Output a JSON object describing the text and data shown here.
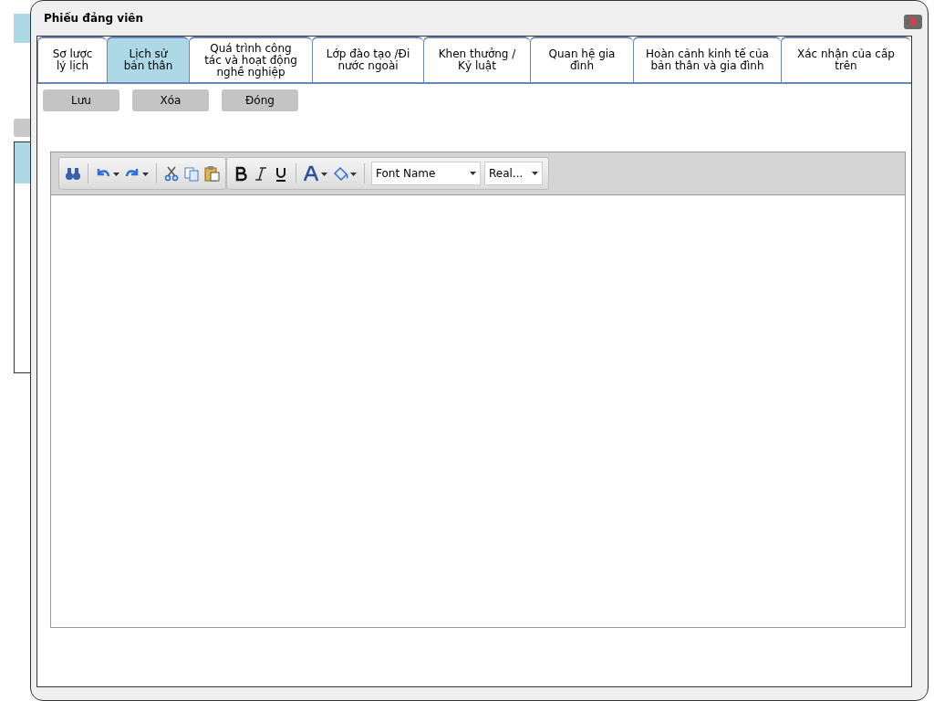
{
  "window": {
    "title": "Phiếu đảng viên",
    "close_label": "X"
  },
  "tabs": [
    {
      "label": "Sơ lược lý lịch",
      "selected": false
    },
    {
      "label": "Lịch sử bản thân",
      "selected": true
    },
    {
      "label": "Quá trình công tác và hoạt động nghề nghiệp",
      "selected": false
    },
    {
      "label": "Lớp đào tạo /Đi nước ngoài",
      "selected": false
    },
    {
      "label": "Khen thưởng / Kỷ luật",
      "selected": false
    },
    {
      "label": "Quan hệ gia đình",
      "selected": false
    },
    {
      "label": "Hoàn cảnh kinh tế của bản thân và gia đình",
      "selected": false
    },
    {
      "label": "Xác nhận của cấp trên",
      "selected": false
    }
  ],
  "buttons": [
    "Lưu",
    "Xóa",
    "Đóng"
  ],
  "editor": {
    "font_name": "Font Name",
    "font_size": "Real..."
  }
}
